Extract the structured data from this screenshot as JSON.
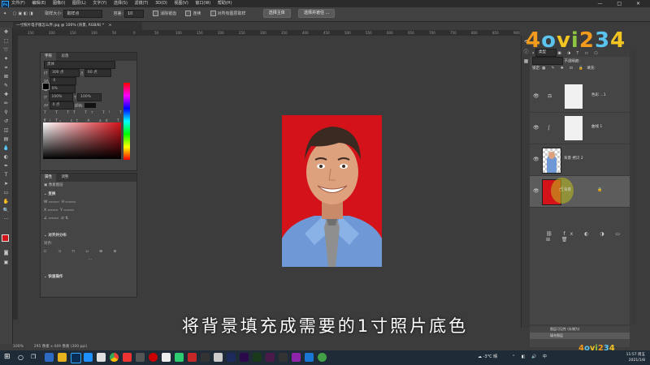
{
  "menu": {
    "logo": "Ps",
    "items": [
      "文件(F)",
      "编辑(E)",
      "图像(I)",
      "图层(L)",
      "文字(Y)",
      "选择(S)",
      "滤镜(T)",
      "3D(D)",
      "视图(V)",
      "窗口(W)",
      "帮助(H)"
    ],
    "window_controls": "— □ ✕"
  },
  "options_bar": {
    "sample_size_label": "取样大小:",
    "sample_size_value": "取样点",
    "tolerance_label": "容差:",
    "tolerance_value": "10",
    "antialias_label": "消除锯齿",
    "contiguous_label": "连续",
    "sample_all_label": "对所有图层取样",
    "select_subject_label": "选择主体",
    "select_mask_label": "选择并遮住 ..."
  },
  "document": {
    "tab_title": "一寸照片电子版怎么弄.jpg @ 100% (背景, RGB/8) *",
    "close_icon": "×"
  },
  "ruler": {
    "ticks": [
      "250",
      "200",
      "150",
      "100",
      "50",
      "0",
      "50",
      "100",
      "150",
      "200",
      "250",
      "300",
      "350",
      "400",
      "450",
      "500",
      "550",
      "600",
      "650",
      "700",
      "750",
      "800",
      "850",
      "900"
    ]
  },
  "char_panel": {
    "tabs": [
      "字符",
      "段落"
    ],
    "font_family": "黑体",
    "font_size": "300 点",
    "leading": "60 点",
    "kerning": "0",
    "tracking": "0%",
    "vscale": "100%",
    "hscale": "100%",
    "baseline": "0 点",
    "color_label": "颜色:",
    "lang": "美国英语",
    "aa": "锐利"
  },
  "props_panel": {
    "tabs": [
      "属性",
      "调整"
    ],
    "layer_type": "像素图层",
    "transform_label": "变换",
    "align_label": "对齐并分布",
    "align_sub": "对齐:",
    "quick_label": "快速操作"
  },
  "layers": {
    "kind_label": "类型",
    "opacity_label": "不透明度:",
    "lock_label": "锁定:",
    "fill_label": "填充:",
    "rows": [
      {
        "name": "色彩 ...1",
        "visible": "👁"
      },
      {
        "name": "曲线 1",
        "visible": "👁"
      },
      {
        "name": "背景 拷贝 2",
        "visible": "👁"
      },
      {
        "name": "背景",
        "visible": "👁"
      }
    ]
  },
  "history": {
    "items": [
      "图层可见性 (存储为)",
      "填充图层"
    ]
  },
  "status": {
    "zoom": "100%",
    "doc_info": "295 像素 x 449 像素 (300 ppi)"
  },
  "subtitle": "将背景填充成需要的1寸照片底色",
  "watermark": "4ovi234",
  "taskbar": {
    "weather": "-3°C 晴",
    "time": "11:57 周五",
    "date": "2021/1/8"
  },
  "colors": {
    "photo_bg": "#d4121a",
    "accent": "#31a8ff"
  }
}
